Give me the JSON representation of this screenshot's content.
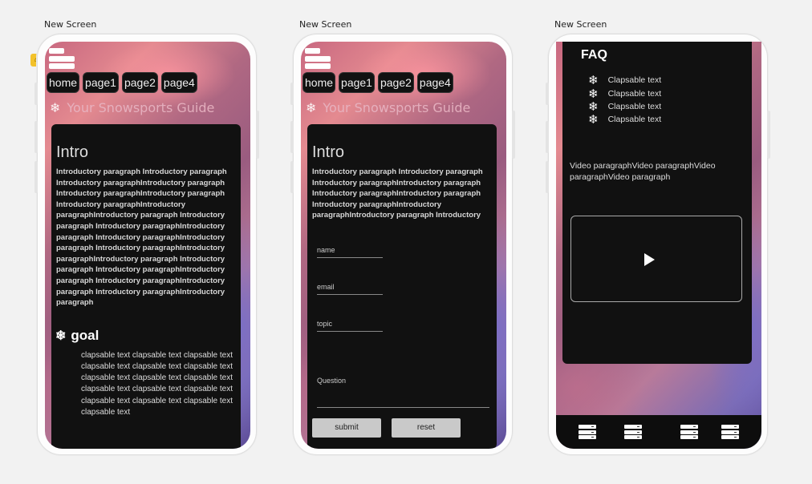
{
  "screens": [
    {
      "label": "New Screen"
    },
    {
      "label": "New Screen"
    },
    {
      "label": "New Screen"
    }
  ],
  "nav": {
    "items": [
      "home",
      "page1",
      "page2",
      "page4"
    ]
  },
  "guide_title": "Your Snowsports Guide",
  "icons": {
    "menu": "menu-icon",
    "snowflake": "snowflake-icon",
    "server": "server-icon",
    "play": "play-icon",
    "home": "home-icon"
  },
  "intro": {
    "heading": "Intro",
    "paragraph": "Introductory paragraph Introductory paragraph Introductory paragraphIntroductory paragraph Introductory paragraphIntroductory paragraph Introductory paragraphIntroductory paragraphIntroductory paragraph Introductory paragraph Introductory paragraphIntroductory paragraph Introductory paragraphIntroductory paragraph Introductory paragraphIntroductory paragraphIntroductory paragraph Introductory paragraph Introductory paragraphIntroductory paragraph Introductory paragraphIntroductory paragraph Introductory paragraphIntroductory paragraph",
    "paragraph_short": "Introductory paragraph Introductory paragraph Introductory paragraphIntroductory paragraph Introductory paragraphIntroductory paragraph Introductory paragraphIntroductory paragraphIntroductory paragraph Introductory"
  },
  "goal": {
    "heading": "goal",
    "text": "clapsable text clapsable text clapsable text clapsable text clapsable text clapsable text clapsable text clapsable text clapsable text clapsable text clapsable text clapsable text clapsable text clapsable text clapsable text clapsable text"
  },
  "form": {
    "name": "name",
    "email": "email",
    "topic": "topic",
    "question": "Question",
    "submit": "submit",
    "reset": "reset"
  },
  "faq": {
    "title": "FAQ",
    "items": [
      "Clapsable text",
      "Clapsable text",
      "Clapsable text",
      "Clapsable text"
    ],
    "video_paragraph": "Video paragraphVideo paragraphVideo paragraphVideo paragraph"
  }
}
